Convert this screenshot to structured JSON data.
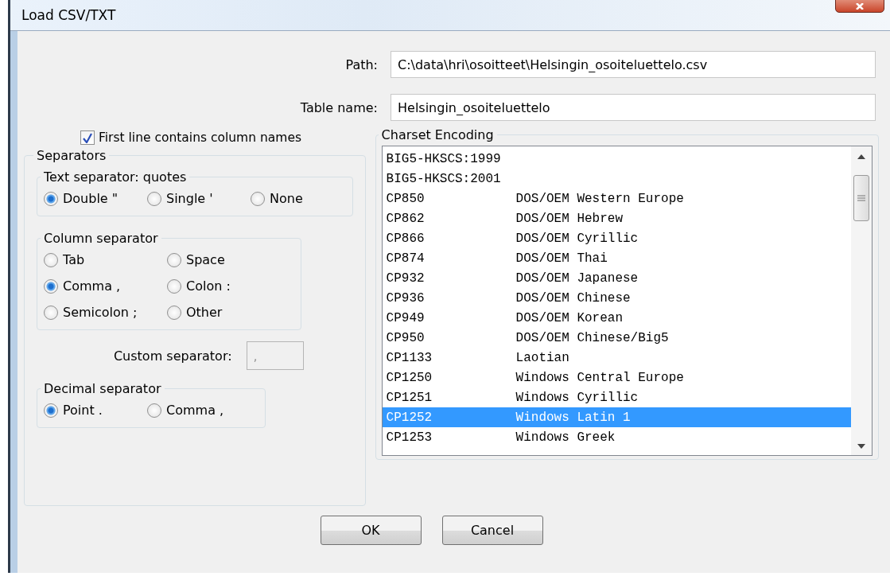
{
  "window": {
    "title": "Load CSV/TXT"
  },
  "path": {
    "label": "Path:",
    "value": "C:\\data\\hri\\osoitteet\\Helsingin_osoiteluettelo.csv"
  },
  "table_name": {
    "label": "Table name:",
    "value": "Helsingin_osoiteluettelo"
  },
  "first_line": {
    "label": "First line contains column names",
    "checked": true
  },
  "separators": {
    "title": "Separators",
    "text_separator": {
      "title": "Text separator: quotes",
      "options": [
        {
          "label": "Double \"",
          "selected": true
        },
        {
          "label": "Single '",
          "selected": false
        },
        {
          "label": "None",
          "selected": false
        }
      ]
    },
    "column_separator": {
      "title": "Column separator",
      "options": [
        {
          "label": "Tab",
          "selected": false
        },
        {
          "label": "Space",
          "selected": false
        },
        {
          "label": "Comma ,",
          "selected": true
        },
        {
          "label": "Colon :",
          "selected": false
        },
        {
          "label": "Semicolon ;",
          "selected": false
        },
        {
          "label": "Other",
          "selected": false
        }
      ]
    },
    "custom_separator": {
      "label": "Custom separator:",
      "value": ","
    },
    "decimal_separator": {
      "title": "Decimal separator",
      "options": [
        {
          "label": "Point .",
          "selected": true
        },
        {
          "label": "Comma ,",
          "selected": false
        }
      ]
    }
  },
  "charset": {
    "title": "Charset Encoding",
    "items": [
      {
        "code": "BIG5-HKSCS:1999",
        "selected": false
      },
      {
        "code": "BIG5-HKSCS:2001",
        "selected": false
      },
      {
        "code": "CP850",
        "name": "DOS/OEM Western Europe",
        "selected": false
      },
      {
        "code": "CP862",
        "name": "DOS/OEM Hebrew",
        "selected": false
      },
      {
        "code": "CP866",
        "name": "DOS/OEM Cyrillic",
        "selected": false
      },
      {
        "code": "CP874",
        "name": "DOS/OEM Thai",
        "selected": false
      },
      {
        "code": "CP932",
        "name": "DOS/OEM Japanese",
        "selected": false
      },
      {
        "code": "CP936",
        "name": "DOS/OEM Chinese",
        "selected": false
      },
      {
        "code": "CP949",
        "name": "DOS/OEM Korean",
        "selected": false
      },
      {
        "code": "CP950",
        "name": "DOS/OEM Chinese/Big5",
        "selected": false
      },
      {
        "code": "CP1133",
        "name": "Laotian",
        "selected": false
      },
      {
        "code": "CP1250",
        "name": "Windows Central Europe",
        "selected": false
      },
      {
        "code": "CP1251",
        "name": "Windows Cyrillic",
        "selected": false
      },
      {
        "code": "CP1252",
        "name": "Windows Latin 1",
        "selected": true
      },
      {
        "code": "CP1253",
        "name": "Windows Greek",
        "selected": false
      }
    ]
  },
  "buttons": [
    "OK",
    "Cancel"
  ]
}
